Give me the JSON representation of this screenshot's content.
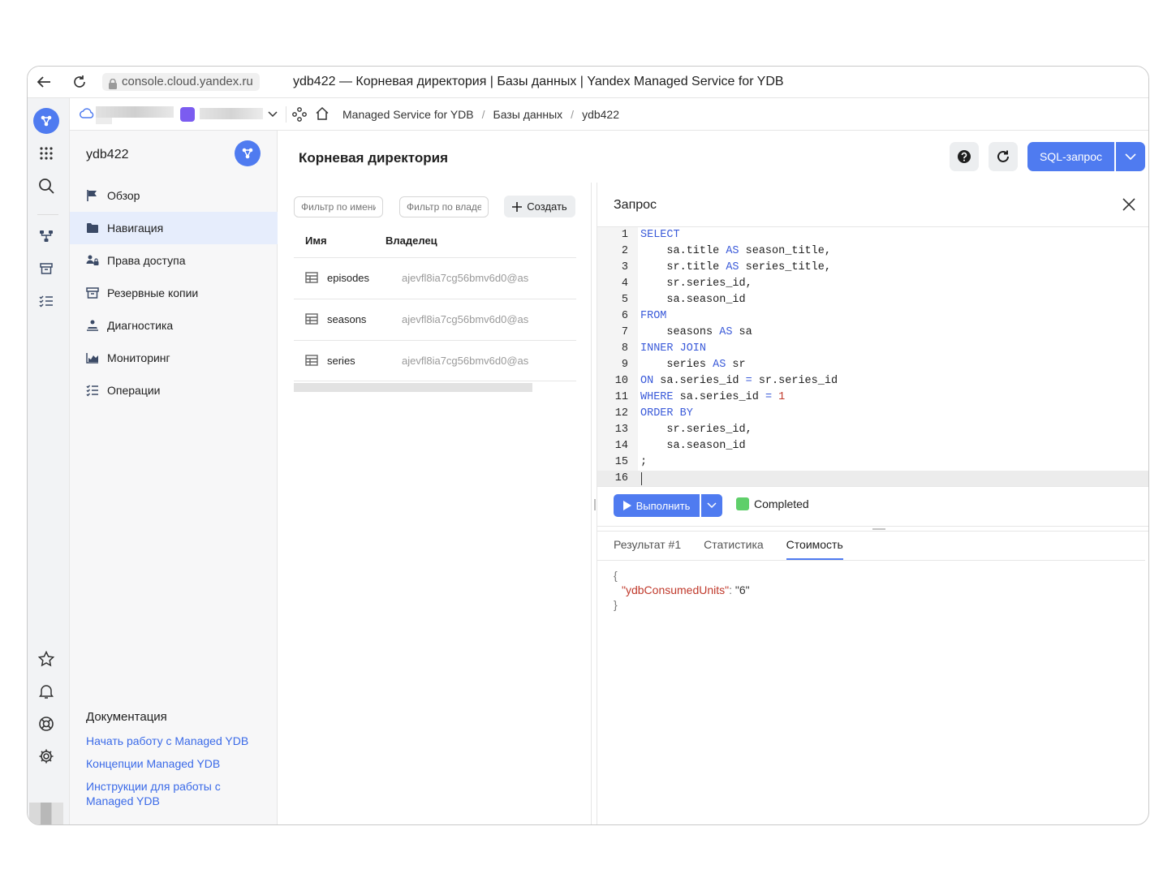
{
  "browser": {
    "url": "console.cloud.yandex.ru",
    "title": "ydb422 — Корневая директория | Базы данных | Yandex Managed Service for YDB"
  },
  "breadcrumbs": [
    "Managed Service for YDB",
    "Базы данных",
    "ydb422"
  ],
  "sidebar": {
    "title": "ydb422",
    "items": [
      {
        "label": "Обзор",
        "icon": "flag-icon"
      },
      {
        "label": "Навигация",
        "icon": "folder-icon",
        "active": true
      },
      {
        "label": "Права доступа",
        "icon": "users-lock-icon"
      },
      {
        "label": "Резервные копии",
        "icon": "archive-icon"
      },
      {
        "label": "Диагностика",
        "icon": "diagnostics-icon"
      },
      {
        "label": "Мониторинг",
        "icon": "chart-icon"
      },
      {
        "label": "Операции",
        "icon": "list-icon"
      }
    ],
    "docs": {
      "title": "Документация",
      "links": [
        "Начать работу с Managed YDB",
        "Концепции Managed YDB",
        "Инструкции для работы с Managed YDB"
      ]
    }
  },
  "main": {
    "title": "Корневая директория",
    "sql_button": "SQL-запрос"
  },
  "browser_pane": {
    "filter_name_placeholder": "Фильтр по имени",
    "filter_owner_placeholder": "Фильтр по владельцу",
    "create_label": "Создать",
    "columns": [
      "Имя",
      "Владелец"
    ],
    "rows": [
      {
        "name": "episodes",
        "owner": "ajevfl8ia7cg56bmv6d0@as"
      },
      {
        "name": "seasons",
        "owner": "ajevfl8ia7cg56bmv6d0@as"
      },
      {
        "name": "series",
        "owner": "ajevfl8ia7cg56bmv6d0@as"
      }
    ]
  },
  "query": {
    "title": "Запрос",
    "lines": [
      "<span class=\"kw\">SELECT</span>",
      "    sa.title <span class=\"kw\">AS</span> season_title,",
      "    sr.title <span class=\"kw\">AS</span> series_title,",
      "    sr.series_id,",
      "    sa.season_id",
      "<span class=\"kw\">FROM</span>",
      "    seasons <span class=\"kw\">AS</span> sa",
      "<span class=\"kw\">INNER JOIN</span>",
      "    series <span class=\"kw\">AS</span> sr",
      "<span class=\"kw\">ON</span> sa.series_id <span class=\"kw\">=</span> sr.series_id",
      "<span class=\"kw\">WHERE</span> sa.series_id <span class=\"kw\">=</span> <span class=\"num\">1</span>",
      "<span class=\"kw\">ORDER BY</span>",
      "    sr.series_id,",
      "    sa.season_id",
      ";",
      ""
    ],
    "run_label": "Выполнить",
    "status": "Completed",
    "status_color": "#5fcf6a",
    "tabs": [
      "Результат #1",
      "Статистика",
      "Стоимость"
    ],
    "active_tab": 2,
    "result_open": "{",
    "result_key": "\"ydbConsumedUnits\"",
    "result_colon": ":",
    "result_value": "\"6\"",
    "result_close": "}"
  },
  "colors": {
    "accent": "#4f7bf0",
    "active_bg": "#e6edfc"
  }
}
